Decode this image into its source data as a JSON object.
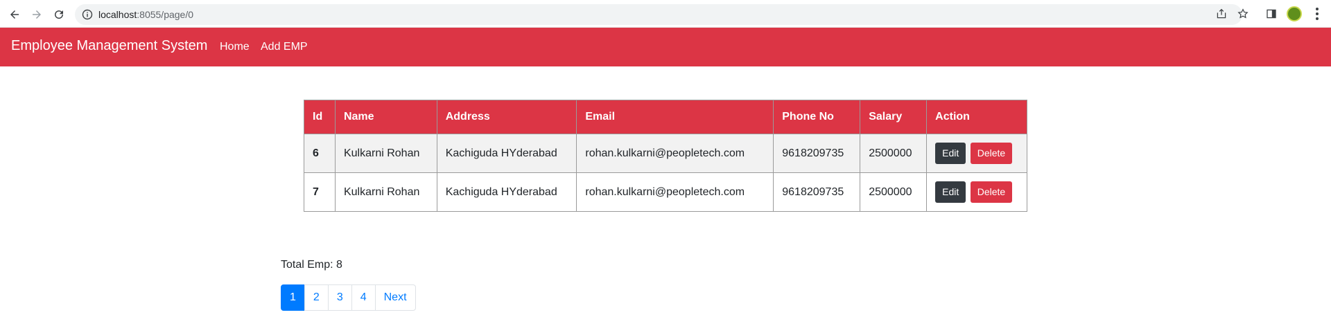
{
  "browser": {
    "url_host": "localhost",
    "url_path": ":8055/page/0"
  },
  "navbar": {
    "brand": "Employee Management System",
    "links": [
      {
        "label": "Home"
      },
      {
        "label": "Add EMP"
      }
    ]
  },
  "table": {
    "headers": [
      "Id",
      "Name",
      "Address",
      "Email",
      "Phone No",
      "Salary",
      "Action"
    ],
    "rows": [
      {
        "id": "6",
        "name": "Kulkarni Rohan",
        "address": "Kachiguda HYderabad",
        "email": "rohan.kulkarni@peopletech.com",
        "phone": "9618209735",
        "salary": "2500000",
        "edit_label": "Edit",
        "delete_label": "Delete"
      },
      {
        "id": "7",
        "name": "Kulkarni Rohan",
        "address": "Kachiguda HYderabad",
        "email": "rohan.kulkarni@peopletech.com",
        "phone": "9618209735",
        "salary": "2500000",
        "edit_label": "Edit",
        "delete_label": "Delete"
      }
    ]
  },
  "footer": {
    "total_text": "Total Emp: 8",
    "pages": [
      "1",
      "2",
      "3",
      "4"
    ],
    "active_page": "1",
    "next_label": "Next"
  },
  "colors": {
    "primary_red": "#dc3545",
    "dark_button": "#343a40",
    "link_blue": "#007bff"
  }
}
